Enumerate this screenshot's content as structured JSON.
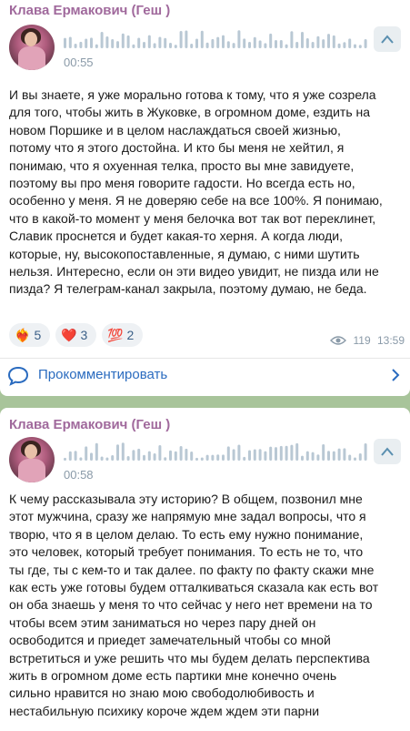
{
  "posts": [
    {
      "author": "Клава Ермакович (Геш )",
      "voice_duration": "00:55",
      "text": "И вы знаете, я уже морально готова к тому, что я уже созрела\nдля того, чтобы жить в Жуковке, в огромном доме, ездить на\nновом Поршике и в целом наслаждаться своей жизнью,\nпотому что я этого достойна. И кто бы меня не хейтил, я\nпонимаю, что я охуенная телка, просто вы мне завидуете,\nпоэтому вы про меня говорите гадости. Но всегда есть но,\nособенно у меня. Я не доверяю себе на все 100%. Я понимаю,\nчто в какой-то момент у меня белочка вот так вот переклинет,\nСлавик проснется и будет какая-то херня. А когда люди,\nкоторые, ну, высокопоставленные, я думаю, с ними шутить\nнельзя. Интересно, если он эти видео увидит, не пизда или не\nпизда? Я телеграм-канал закрыла, поэтому думаю, не беда.",
      "reactions": [
        {
          "emoji": "❤️‍🔥",
          "count": "5"
        },
        {
          "emoji": "❤️",
          "count": "3"
        },
        {
          "emoji": "💯",
          "count": "2"
        }
      ],
      "views": "119",
      "time": "13:59",
      "comment_label": "Прокомментировать"
    },
    {
      "author": "Клава Ермакович (Геш )",
      "voice_duration": "00:58",
      "text": "К чему рассказывала эту историю? В общем, позвонил мне\nэтот мужчина, сразу же напрямую мне задал вопросы, что я\nтворю, что я в целом делаю. То есть ему нужно понимание,\nэто человек, который требует понимания. То есть не то, что\nты где, ты с кем-то и так далее. по факту по факту скажи мне\nкак есть уже готовы будем отталкиваться сказала как есть вот\nон оба знаешь у меня то что сейчас у него нет времени на то\nчтобы всем этим заниматься но через пару дней он\nосвободится и приедет замечательный чтобы со мной\nвстретиться и уже решить что мы будем делать перспектива\nжить в огромном доме есть партики мне конечно очень\nсильно нравится но знаю мою свободолюбивость и\nнестабильную психику короче ждем ждем эти парни"
    }
  ],
  "colors": {
    "author": "#a0699c",
    "link": "#2a6bbf",
    "background": "#a8c49a",
    "meta": "#8a9aa8"
  },
  "icons": {
    "expand": "chevron-up-icon",
    "views": "eye-icon",
    "comment": "comment-icon",
    "comment_arrow": "chevron-right-icon"
  }
}
